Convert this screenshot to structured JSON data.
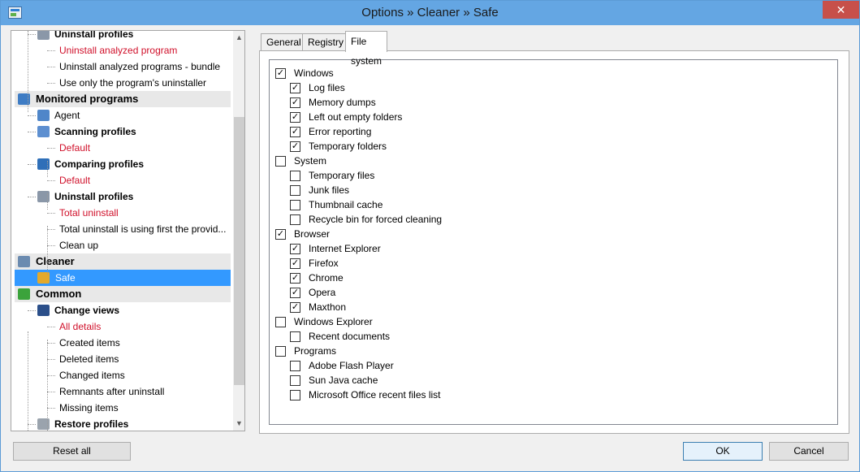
{
  "window": {
    "title": "Options » Cleaner » Safe",
    "close_glyph": "✕"
  },
  "tree": {
    "items": [
      {
        "label": "Uninstall profiles",
        "kind": "sub",
        "icon": "trash-icon"
      },
      {
        "label": "Uninstall analyzed program",
        "kind": "leaf",
        "red": true
      },
      {
        "label": "Uninstall analyzed programs - bundle",
        "kind": "leaf"
      },
      {
        "label": "Use only the program's uninstaller",
        "kind": "leaf"
      },
      {
        "label": "Monitored programs",
        "kind": "group",
        "icon": "monitor-programs-icon"
      },
      {
        "label": "Agent",
        "kind": "sub-plain",
        "icon": "agent-icon"
      },
      {
        "label": "Scanning profiles",
        "kind": "sub",
        "icon": "scan-icon"
      },
      {
        "label": "Default",
        "kind": "leaf",
        "red": true
      },
      {
        "label": "Comparing profiles",
        "kind": "sub",
        "icon": "scales-icon"
      },
      {
        "label": "Default",
        "kind": "leaf",
        "red": true
      },
      {
        "label": "Uninstall profiles",
        "kind": "sub",
        "icon": "trash-icon"
      },
      {
        "label": "Total uninstall",
        "kind": "leaf",
        "red": true
      },
      {
        "label": "Total uninstall is using first the provid...",
        "kind": "leaf"
      },
      {
        "label": "Clean up",
        "kind": "leaf"
      },
      {
        "label": "Cleaner",
        "kind": "group",
        "icon": "cleaner-icon"
      },
      {
        "label": "Safe",
        "kind": "selected",
        "icon": "broom-icon"
      },
      {
        "label": "Common",
        "kind": "group",
        "icon": "green-arrow-icon"
      },
      {
        "label": "Change views",
        "kind": "sub",
        "icon": "glasses-icon"
      },
      {
        "label": "All details",
        "kind": "leaf",
        "red": true
      },
      {
        "label": "Created items",
        "kind": "leaf"
      },
      {
        "label": "Deleted items",
        "kind": "leaf"
      },
      {
        "label": "Changed items",
        "kind": "leaf"
      },
      {
        "label": "Remnants after uninstall",
        "kind": "leaf"
      },
      {
        "label": "Missing items",
        "kind": "leaf"
      },
      {
        "label": "Restore profiles",
        "kind": "sub",
        "icon": "drive-icon"
      }
    ]
  },
  "tabs": [
    {
      "label": "General",
      "active": false
    },
    {
      "label": "Registry",
      "active": false
    },
    {
      "label": "File system",
      "active": true
    }
  ],
  "options": [
    {
      "label": "Windows",
      "level": 0,
      "checked": true
    },
    {
      "label": "Log files",
      "level": 1,
      "checked": true
    },
    {
      "label": "Memory dumps",
      "level": 1,
      "checked": true
    },
    {
      "label": "Left out empty folders",
      "level": 1,
      "checked": true
    },
    {
      "label": "Error reporting",
      "level": 1,
      "checked": true
    },
    {
      "label": "Temporary folders",
      "level": 1,
      "checked": true
    },
    {
      "label": "System",
      "level": 0,
      "checked": false
    },
    {
      "label": "Temporary files",
      "level": 1,
      "checked": false
    },
    {
      "label": "Junk files",
      "level": 1,
      "checked": false
    },
    {
      "label": "Thumbnail cache",
      "level": 1,
      "checked": false
    },
    {
      "label": "Recycle bin for forced cleaning",
      "level": 1,
      "checked": false
    },
    {
      "label": "Browser",
      "level": 0,
      "checked": true
    },
    {
      "label": "Internet Explorer",
      "level": 1,
      "checked": true
    },
    {
      "label": "Firefox",
      "level": 1,
      "checked": true
    },
    {
      "label": "Chrome",
      "level": 1,
      "checked": true
    },
    {
      "label": "Opera",
      "level": 1,
      "checked": true
    },
    {
      "label": "Maxthon",
      "level": 1,
      "checked": true
    },
    {
      "label": "Windows Explorer",
      "level": 0,
      "checked": false
    },
    {
      "label": "Recent documents",
      "level": 1,
      "checked": false
    },
    {
      "label": "Programs",
      "level": 0,
      "checked": false
    },
    {
      "label": "Adobe Flash Player",
      "level": 1,
      "checked": false
    },
    {
      "label": "Sun Java cache",
      "level": 1,
      "checked": false
    },
    {
      "label": "Microsoft Office recent files list",
      "level": 1,
      "checked": false
    }
  ],
  "buttons": {
    "reset_all": "Reset all",
    "ok": "OK",
    "cancel": "Cancel"
  },
  "colors": {
    "titlebar": "#64a6e3",
    "selection": "#3399ff",
    "default_profile_text": "#d0102a",
    "close_button": "#c7504a"
  }
}
